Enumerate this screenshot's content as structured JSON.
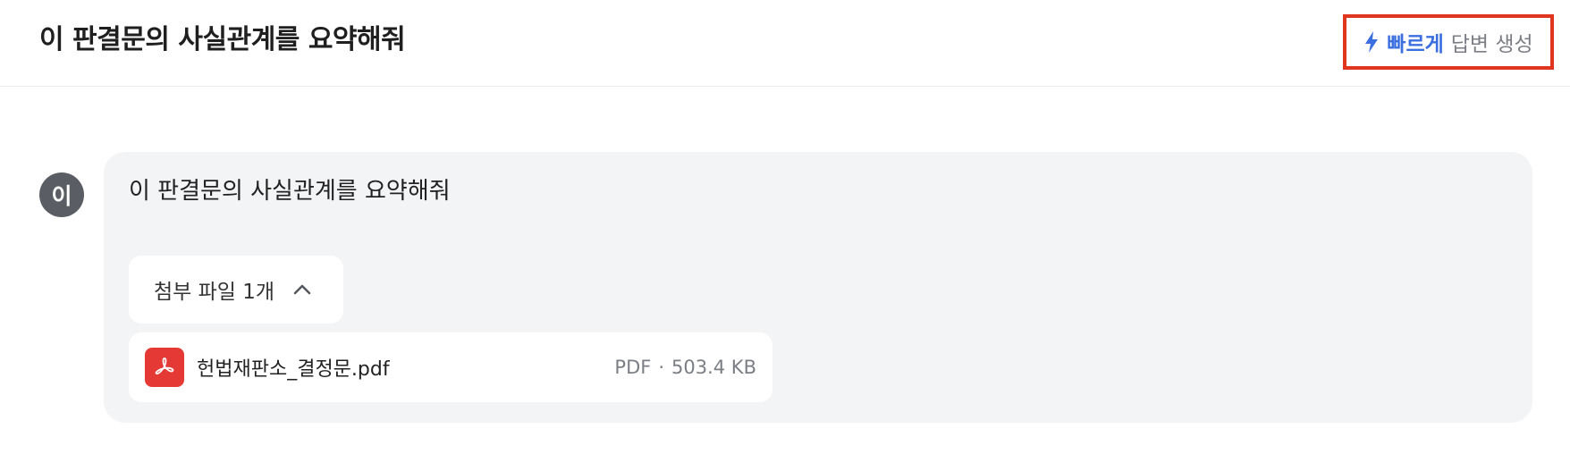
{
  "header": {
    "title": "이 판결문의 사실관계를 요약해줘",
    "mode_button": {
      "icon": "bolt-icon",
      "fast_label": "빠르게",
      "rest_label": "답변 생성",
      "accent_color": "#3b6fe0",
      "highlight_border_color": "#e0351f"
    }
  },
  "message": {
    "avatar_initial": "이",
    "text": "이 판결문의 사실관계를 요약해줘",
    "attachments": {
      "toggle_label": "첨부 파일 1개",
      "toggle_icon": "chevron-up-icon",
      "files": [
        {
          "icon": "pdf-icon",
          "name": "헌법재판소_결정문.pdf",
          "type": "PDF",
          "separator": "·",
          "size": "503.4 KB"
        }
      ]
    }
  }
}
